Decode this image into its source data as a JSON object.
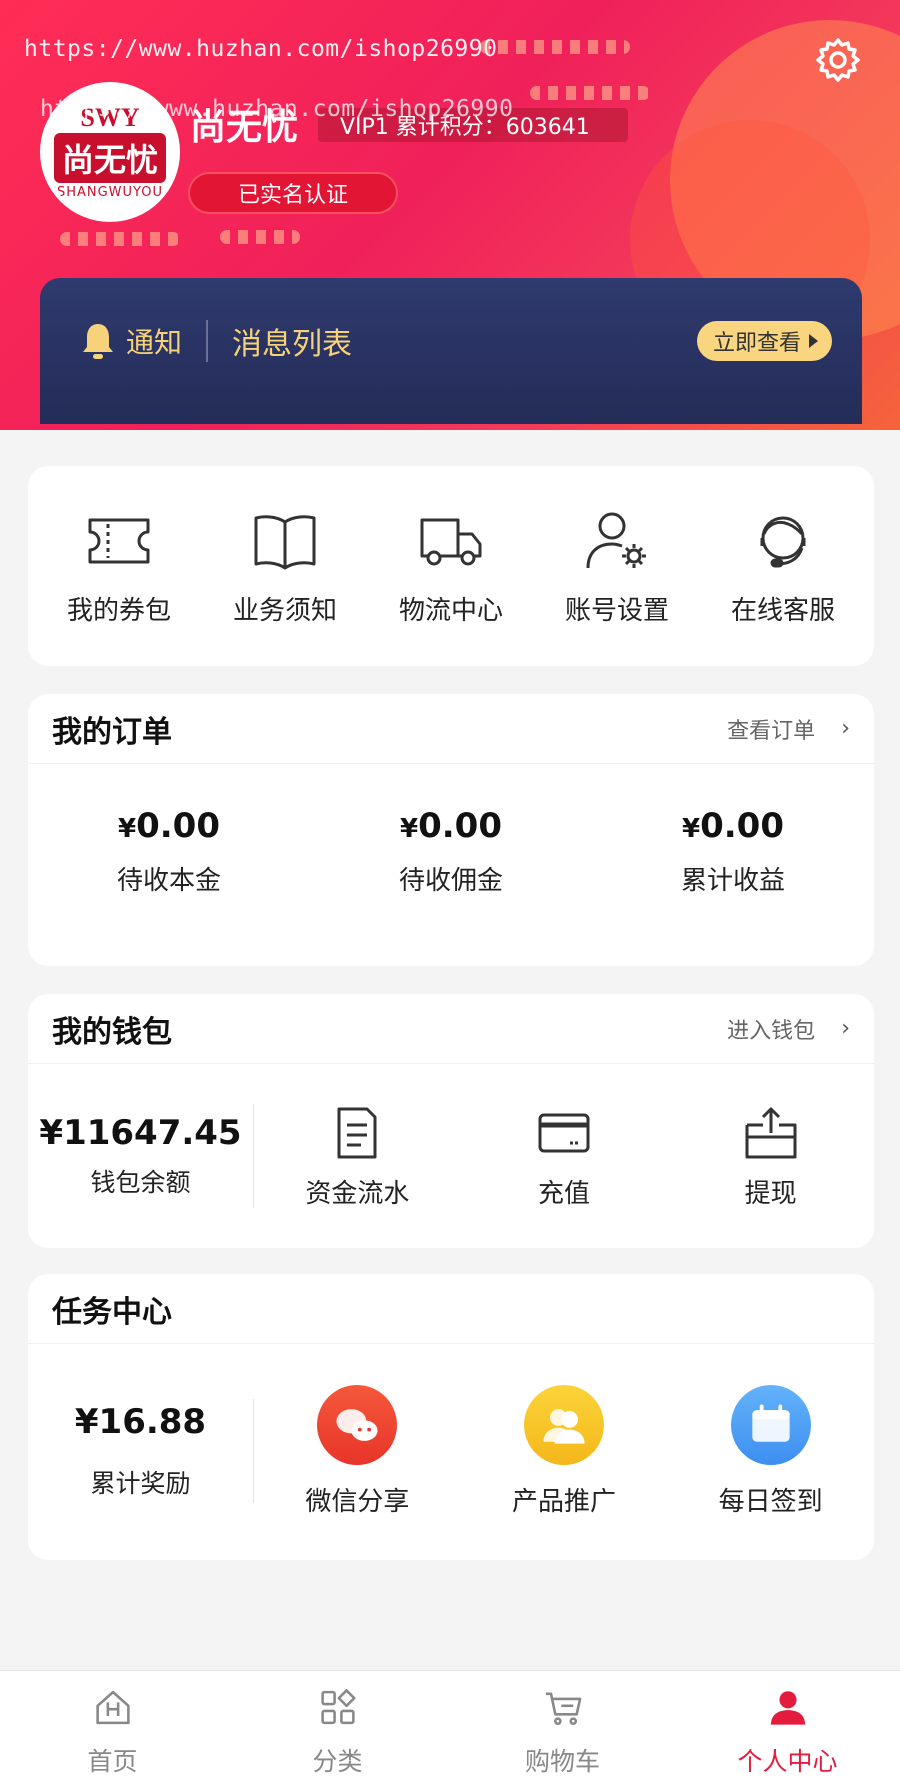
{
  "header": {
    "watermark1": "https://www.huzhan.com/ishop26990",
    "watermark2": "https://www.huzhan.com/ishop26990",
    "username": "尚无忧",
    "vip_text": "VIP1 累计积分：603641",
    "verify_badge": "已实名认证",
    "avatar": {
      "top": "SWY",
      "main": "尚无忧",
      "sub": "SHANGWUYOU"
    },
    "settings_icon": "gear-icon",
    "gradient_colors": [
      "#ff2d55",
      "#f5643a"
    ]
  },
  "notice": {
    "label": "通知",
    "list_label": "消息列表",
    "view_button": "立即查看",
    "accent": "#f6d37a",
    "background": "#2f3a6e"
  },
  "quick_menu": [
    {
      "label": "我的券包",
      "icon": "ticket-icon"
    },
    {
      "label": "业务须知",
      "icon": "book-icon"
    },
    {
      "label": "物流中心",
      "icon": "truck-icon"
    },
    {
      "label": "账号设置",
      "icon": "user-gear-icon"
    },
    {
      "label": "在线客服",
      "icon": "headset-icon"
    }
  ],
  "orders": {
    "title": "我的订单",
    "link": "查看订单",
    "stats": [
      {
        "currency": "¥",
        "amount": "0.00",
        "label": "待收本金"
      },
      {
        "currency": "¥",
        "amount": "0.00",
        "label": "待收佣金"
      },
      {
        "currency": "¥",
        "amount": "0.00",
        "label": "累计收益"
      }
    ]
  },
  "wallet": {
    "title": "我的钱包",
    "link": "进入钱包",
    "balance": "¥11647.45",
    "balance_label": "钱包余额",
    "actions": [
      {
        "label": "资金流水",
        "icon": "document-icon"
      },
      {
        "label": "充值",
        "icon": "card-icon"
      },
      {
        "label": "提现",
        "icon": "withdraw-icon"
      }
    ]
  },
  "tasks": {
    "title": "任务中心",
    "reward": "¥16.88",
    "reward_label": "累计奖励",
    "actions": [
      {
        "label": "微信分享",
        "icon": "wechat-icon",
        "color": "#f0432f"
      },
      {
        "label": "产品推广",
        "icon": "users-icon",
        "color": "#f7c21d"
      },
      {
        "label": "每日签到",
        "icon": "calendar-icon",
        "color": "#4a9ef5"
      }
    ]
  },
  "tabbar": {
    "active_color": "#e31c3d",
    "items": [
      {
        "label": "首页",
        "icon": "home-icon"
      },
      {
        "label": "分类",
        "icon": "category-icon"
      },
      {
        "label": "购物车",
        "icon": "cart-icon"
      },
      {
        "label": "个人中心",
        "icon": "person-icon"
      }
    ]
  }
}
